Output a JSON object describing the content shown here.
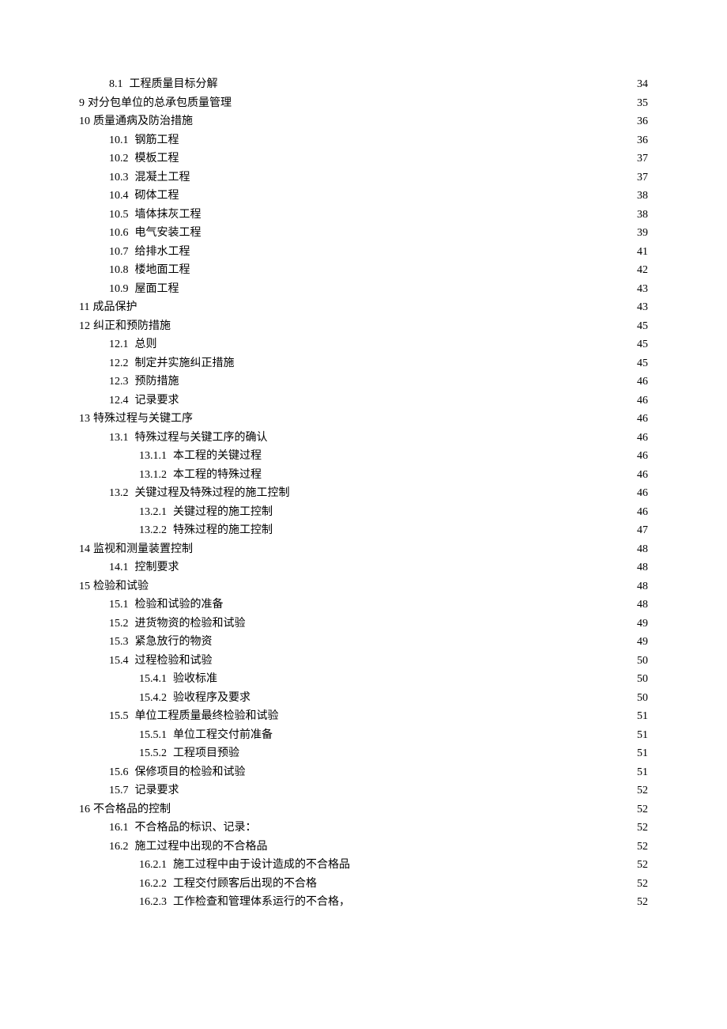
{
  "toc": [
    {
      "level": 2,
      "num": "8.1",
      "title": "工程质量目标分解",
      "page": 34
    },
    {
      "level": 1,
      "num": "9",
      "title": "对分包单位的总承包质量管理",
      "page": 35
    },
    {
      "level": 1,
      "num": "10",
      "title": "质量通病及防治措施",
      "page": 36
    },
    {
      "level": 2,
      "num": "10.1",
      "title": "钢筋工程",
      "page": 36
    },
    {
      "level": 2,
      "num": "10.2",
      "title": "模板工程",
      "page": 37
    },
    {
      "level": 2,
      "num": "10.3",
      "title": "混凝土工程",
      "page": 37
    },
    {
      "level": 2,
      "num": "10.4",
      "title": "砌体工程",
      "page": 38
    },
    {
      "level": 2,
      "num": "10.5",
      "title": "墙体抹灰工程",
      "page": 38
    },
    {
      "level": 2,
      "num": "10.6",
      "title": "电气安装工程",
      "page": 39
    },
    {
      "level": 2,
      "num": "10.7",
      "title": "给排水工程",
      "page": 41
    },
    {
      "level": 2,
      "num": "10.8",
      "title": "楼地面工程",
      "page": 42
    },
    {
      "level": 2,
      "num": "10.9",
      "title": "屋面工程",
      "page": 43
    },
    {
      "level": 1,
      "num": "11",
      "title": "成品保护",
      "page": 43
    },
    {
      "level": 1,
      "num": "12",
      "title": "纠正和预防措施",
      "page": 45
    },
    {
      "level": 2,
      "num": "12.1",
      "title": "总则",
      "page": 45
    },
    {
      "level": 2,
      "num": "12.2",
      "title": "制定并实施纠正措施",
      "page": 45
    },
    {
      "level": 2,
      "num": "12.3",
      "title": "预防措施",
      "page": 46
    },
    {
      "level": 2,
      "num": "12.4",
      "title": "记录要求",
      "page": 46
    },
    {
      "level": 1,
      "num": "13",
      "title": "特殊过程与关键工序",
      "page": 46
    },
    {
      "level": 2,
      "num": "13.1",
      "title": "特殊过程与关键工序的确认",
      "page": 46
    },
    {
      "level": 3,
      "num": "13.1.1",
      "title": "本工程的关键过程",
      "page": 46
    },
    {
      "level": 3,
      "num": "13.1.2",
      "title": "本工程的特殊过程",
      "page": 46
    },
    {
      "level": 2,
      "num": "13.2",
      "title": "关键过程及特殊过程的施工控制",
      "page": 46
    },
    {
      "level": 3,
      "num": "13.2.1",
      "title": "关键过程的施工控制",
      "page": 46
    },
    {
      "level": 3,
      "num": "13.2.2",
      "title": "特殊过程的施工控制",
      "page": 47
    },
    {
      "level": 1,
      "num": "14",
      "title": "监视和测量装置控制",
      "page": 48
    },
    {
      "level": 2,
      "num": "14.1",
      "title": "控制要求",
      "page": 48
    },
    {
      "level": 1,
      "num": "15",
      "title": "检验和试验",
      "page": 48
    },
    {
      "level": 2,
      "num": "15.1",
      "title": "检验和试验的准备",
      "page": 48
    },
    {
      "level": 2,
      "num": "15.2",
      "title": "进货物资的检验和试验",
      "page": 49
    },
    {
      "level": 2,
      "num": "15.3",
      "title": "紧急放行的物资",
      "page": 49
    },
    {
      "level": 2,
      "num": "15.4",
      "title": "过程检验和试验",
      "page": 50
    },
    {
      "level": 3,
      "num": "15.4.1",
      "title": "验收标准",
      "page": 50
    },
    {
      "level": 3,
      "num": "15.4.2",
      "title": "验收程序及要求",
      "page": 50
    },
    {
      "level": 2,
      "num": "15.5",
      "title": "单位工程质量最终检验和试验",
      "page": 51
    },
    {
      "level": 3,
      "num": "15.5.1",
      "title": "单位工程交付前准备",
      "page": 51
    },
    {
      "level": 3,
      "num": "15.5.2",
      "title": "工程项目预验",
      "page": 51
    },
    {
      "level": 2,
      "num": "15.6",
      "title": "保修项目的检验和试验",
      "page": 51
    },
    {
      "level": 2,
      "num": "15.7",
      "title": "记录要求",
      "page": 52
    },
    {
      "level": 1,
      "num": "16",
      "title": "不合格品的控制",
      "page": 52
    },
    {
      "level": 2,
      "num": "16.1",
      "title": "不合格品的标识、记录：",
      "page": 52
    },
    {
      "level": 2,
      "num": "16.2",
      "title": "施工过程中出现的不合格品",
      "page": 52
    },
    {
      "level": 3,
      "num": "16.2.1",
      "title": "施工过程中由于设计造成的不合格品",
      "page": 52
    },
    {
      "level": 3,
      "num": "16.2.2",
      "title": "工程交付顾客后出现的不合格",
      "page": 52
    },
    {
      "level": 3,
      "num": "16.2.3",
      "title": "工作检查和管理体系运行的不合格，",
      "page": 52
    }
  ]
}
